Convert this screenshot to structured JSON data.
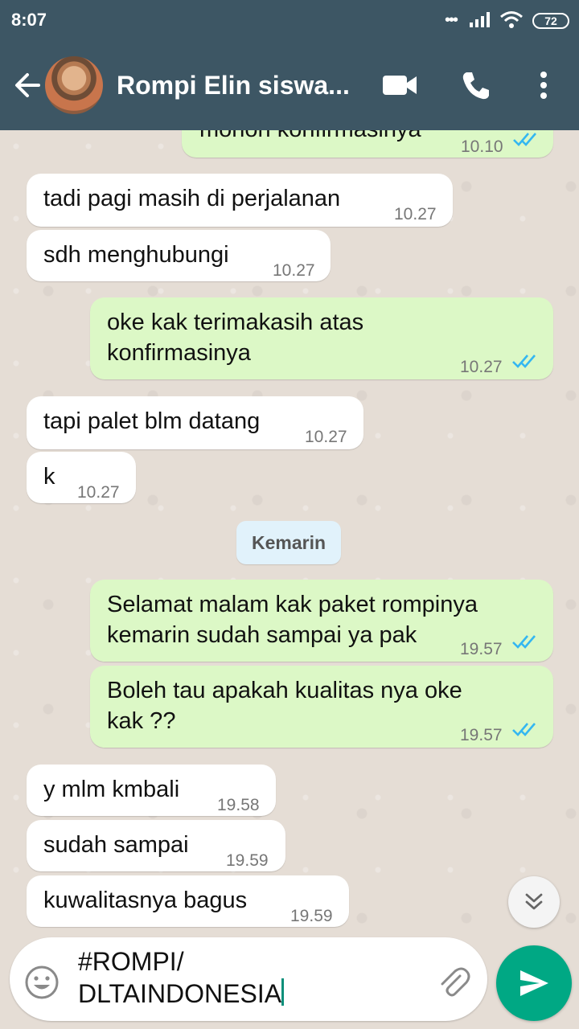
{
  "status_bar": {
    "time": "8:07",
    "battery": "72"
  },
  "header": {
    "title": "Rompi Elin siswa..."
  },
  "messages": [
    {
      "dir": "out",
      "text": "mohon konfirmasinya",
      "time": "10.10",
      "ticks": "read"
    },
    {
      "dir": "in",
      "text": "tadi pagi masih di perjalanan",
      "time": "10.27"
    },
    {
      "dir": "in",
      "text": "sdh menghubungi",
      "time": "10.27"
    },
    {
      "dir": "out",
      "line1": "oke kak terimakasih atas",
      "line2": "konfirmasinya",
      "time": "10.27",
      "ticks": "read"
    },
    {
      "dir": "in",
      "text": "tapi palet blm datang",
      "time": "10.27"
    },
    {
      "dir": "in",
      "text": "k",
      "time": "10.27"
    },
    {
      "dir": "out",
      "line1": "Selamat malam kak paket rompinya",
      "line2": "kemarin sudah sampai ya pak",
      "time": "19.57",
      "ticks": "read"
    },
    {
      "dir": "out",
      "line1": "Boleh tau apakah kualitas nya oke",
      "line2": "kak ??",
      "time": "19.57",
      "ticks": "read"
    },
    {
      "dir": "in",
      "text": "y mlm kmbali",
      "time": "19.58"
    },
    {
      "dir": "in",
      "text": "sudah sampai",
      "time": "19.59"
    },
    {
      "dir": "in",
      "text": "kuwalitasnya bagus",
      "time": "19.59"
    }
  ],
  "day_separator": "Kemarin",
  "composer": {
    "line1": "#ROMPI/",
    "line2": "DLTAINDONESIA"
  },
  "colors": {
    "header": "#3d5664",
    "outgoing_bubble": "#dcf8c6",
    "incoming_bubble": "#ffffff",
    "send_button": "#00a884",
    "read_ticks": "#34b7f1"
  },
  "icons": [
    "back-arrow-icon",
    "video-call-icon",
    "phone-icon",
    "more-vert-icon",
    "emoji-icon",
    "attach-icon",
    "send-icon",
    "double-chevron-down-icon",
    "double-check-icon"
  ]
}
